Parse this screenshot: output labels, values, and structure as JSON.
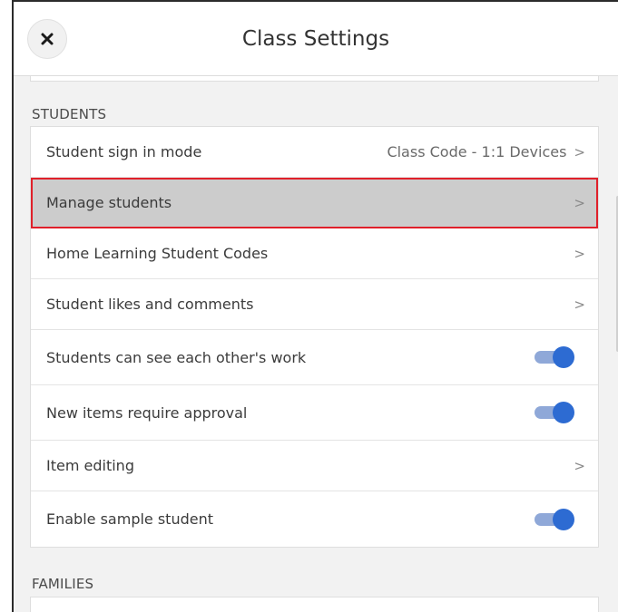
{
  "header": {
    "title": "Class Settings",
    "close_label": "✕"
  },
  "students_section": {
    "label": "STUDENTS",
    "rows": [
      {
        "label": "Student sign in mode",
        "value": "Class Code - 1:1 Devices",
        "chevron": ">"
      },
      {
        "label": "Manage students",
        "chevron": ">",
        "highlighted": true
      },
      {
        "label": "Home Learning Student Codes",
        "chevron": ">"
      },
      {
        "label": "Student likes and comments",
        "chevron": ">"
      },
      {
        "label": "Students can see each other's work",
        "toggle": true
      },
      {
        "label": "New items require approval",
        "toggle": true
      },
      {
        "label": "Item editing",
        "chevron": ">"
      },
      {
        "label": "Enable sample student",
        "toggle": true
      }
    ]
  },
  "families_section": {
    "label": "FAMILIES"
  },
  "colors": {
    "accent": "#2d6bd2",
    "toggle_track": "#8fa8d8",
    "highlight_border": "#e0202a",
    "highlight_bg": "#cccccc"
  }
}
